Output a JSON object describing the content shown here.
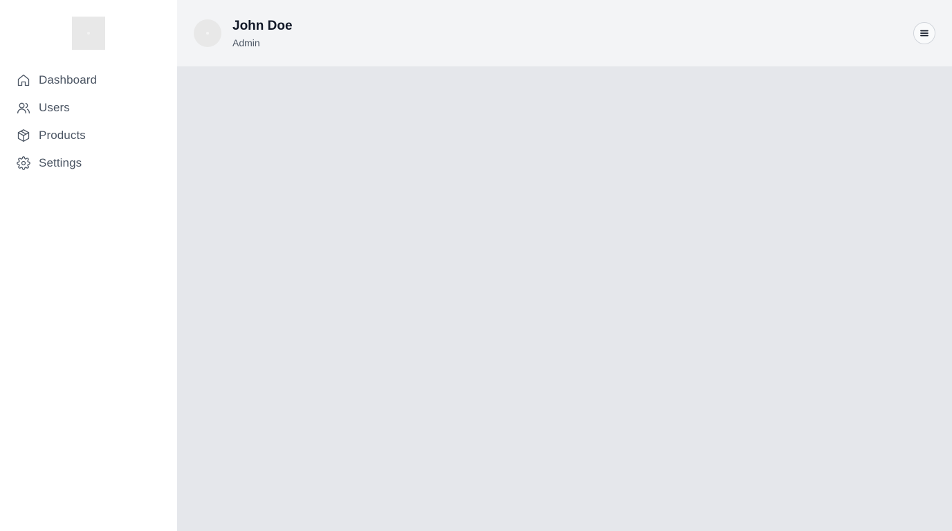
{
  "sidebar": {
    "logo": "logo-placeholder",
    "items": [
      {
        "label": "Dashboard",
        "icon": "home-icon"
      },
      {
        "label": "Users",
        "icon": "users-icon"
      },
      {
        "label": "Products",
        "icon": "package-icon"
      },
      {
        "label": "Settings",
        "icon": "gear-icon"
      }
    ]
  },
  "header": {
    "user": {
      "name": "John Doe",
      "role": "Admin",
      "avatar": "avatar-placeholder"
    },
    "menu_icon": "hamburger-menu-icon"
  },
  "colors": {
    "sidebar_bg": "#ffffff",
    "header_bg": "#f3f4f6",
    "main_bg": "#e5e7eb",
    "nav_text": "#4b5563",
    "name_text": "#111827"
  }
}
